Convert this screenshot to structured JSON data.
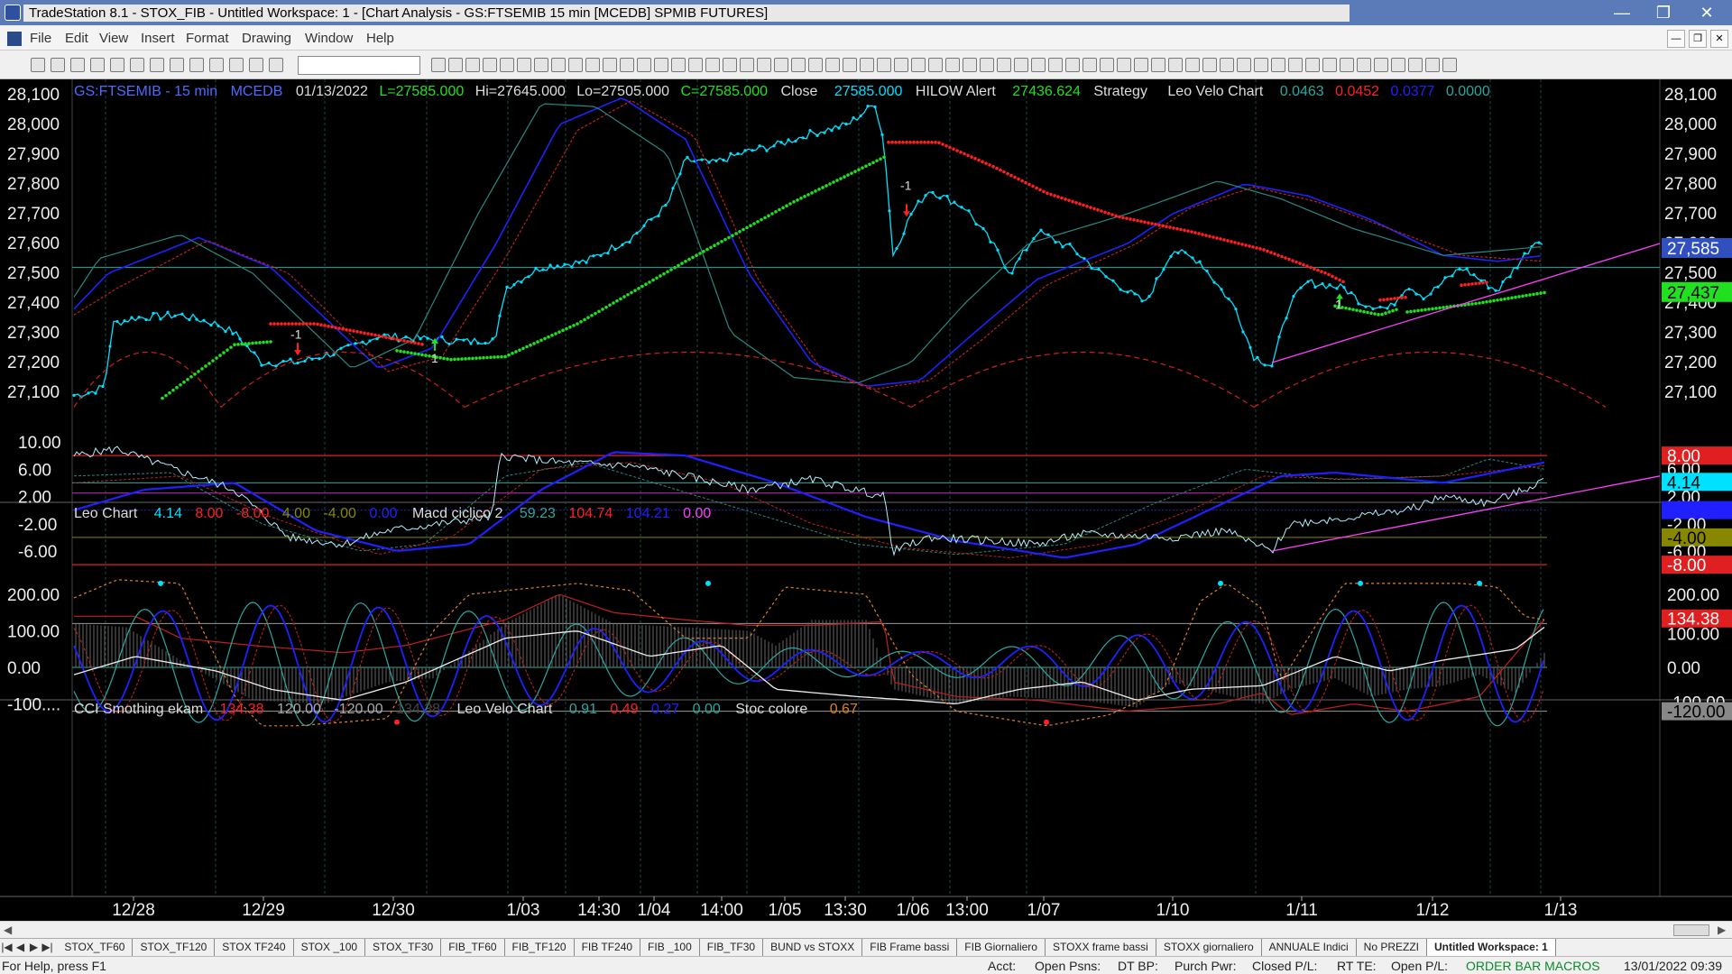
{
  "window": {
    "title": "TradeStation 8.1 - STOX_FIB - Untitled Workspace:  1 - [Chart Analysis - GS:FTSEMIB  15 min  [MCEDB] SPMIB FUTURES]"
  },
  "menu": [
    "File",
    "Edit",
    "View",
    "Insert",
    "Format",
    "Drawing",
    "Window",
    "Help"
  ],
  "icons": {
    "app": "tradestation-logo-icon",
    "minimize": "minimize-icon",
    "restore": "restore-icon",
    "close": "close-icon"
  },
  "colors": {
    "bg": "#000000",
    "cyan": "#00e0ff",
    "red": "#ff2020",
    "green": "#20e020",
    "magenta": "#ff40ff",
    "blue": "#2020ff",
    "grid": "#446666",
    "teal": "#2aa8a0"
  },
  "price": {
    "header": {
      "symbol": "GS:FTSEMIB - 15 min",
      "sess": "MCEDB",
      "date": "01/13/2022",
      "last": "L=27585.000",
      "hi": "Hi=27645.000",
      "lo": "Lo=27505.000",
      "close": "C=27585.000",
      "closelbl": "Close",
      "closeval": "27585.000",
      "hilow": "HILOW Alert",
      "hilowval": "27436.624",
      "strategy": "Strategy",
      "velo": "Leo Velo Chart",
      "v1": "0.0463",
      "v2": "0.0452",
      "v3": "0.0377",
      "v4": "0.0000"
    },
    "ylabels": [
      "28,100",
      "28,000",
      "27,900",
      "27,800",
      "27,700",
      "27,600",
      "27,500",
      "27,400",
      "27,300",
      "27,200",
      "27,100"
    ],
    "lasttag": "27,585",
    "greentag": "27,437",
    "arrow_labels": [
      "-1",
      "1",
      "-1",
      "1"
    ]
  },
  "macd": {
    "header": {
      "t1": "Leo Chart",
      "v1": "4.14",
      "v2": "8.00",
      "v3": "-8.00",
      "v4": "4.00",
      "v5": "-4.00",
      "v6": "0.00",
      "t2": "Macd ciclico 2",
      "m1": "59.23",
      "m2": "104.74",
      "m3": "104.21",
      "m4": "0.00"
    },
    "ylabels": [
      "10.00",
      "6.00",
      "2.00",
      "-2.00",
      "-6.00"
    ],
    "tags": [
      "8.00",
      "6.00",
      "4.14",
      "2.00",
      "0.00",
      "-2.00",
      "-4.00",
      "-6.00",
      "-8.00"
    ]
  },
  "cci": {
    "header": {
      "t1": "CCI Smothing ekam",
      "v1": "134.38",
      "v2": "120.00",
      "v3": "-120.00",
      "v4": "134.38",
      "t2": "Leo Velo Chart",
      "w1": "0.91",
      "w2": "0.49",
      "w3": "0.27",
      "w4": "0.00",
      "t3": "Stoc colore",
      "s1": "0.67"
    },
    "ylabels": [
      "200.00",
      "100.00",
      "0.00",
      "-100...."
    ],
    "tags": [
      "200.00",
      "134.38",
      "100.00",
      "0.00",
      "-100.00",
      "-120.00"
    ]
  },
  "xlabels": [
    "12/28",
    "12/29",
    "12/30",
    "1/03",
    "14:30",
    "1/04",
    "14:00",
    "1/05",
    "13:30",
    "1/06",
    "13:00",
    "1/07",
    "1/10",
    "1/11",
    "1/12",
    "1/13"
  ],
  "tabs": [
    "STOX_TF60",
    "STOX_TF120",
    "STOX TF240",
    "STOX _100",
    "STOX_TF30",
    "FIB_TF60",
    "FIB_TF120",
    "FIB TF240",
    "FIB _100",
    "FIB_TF30",
    "BUND vs STOXX",
    "FIB Frame bassi",
    "FIB Giornaliero",
    "STOXX frame bassi",
    "STOXX giornaliero",
    "ANNUALE Indici",
    "No PREZZI",
    "Untitled Workspace: 1"
  ],
  "status": {
    "help": "For Help, press F1",
    "acct": "Acct:",
    "open": "Open Psns:",
    "dtbp": "DT BP:",
    "purch": "Purch Pwr:",
    "closed": "Closed P/L:",
    "rtte": "RT TE:",
    "openpl": "Open P/L:",
    "macros": "ORDER BAR  MACROS",
    "datetime": "13/01/2022 09:39"
  }
}
